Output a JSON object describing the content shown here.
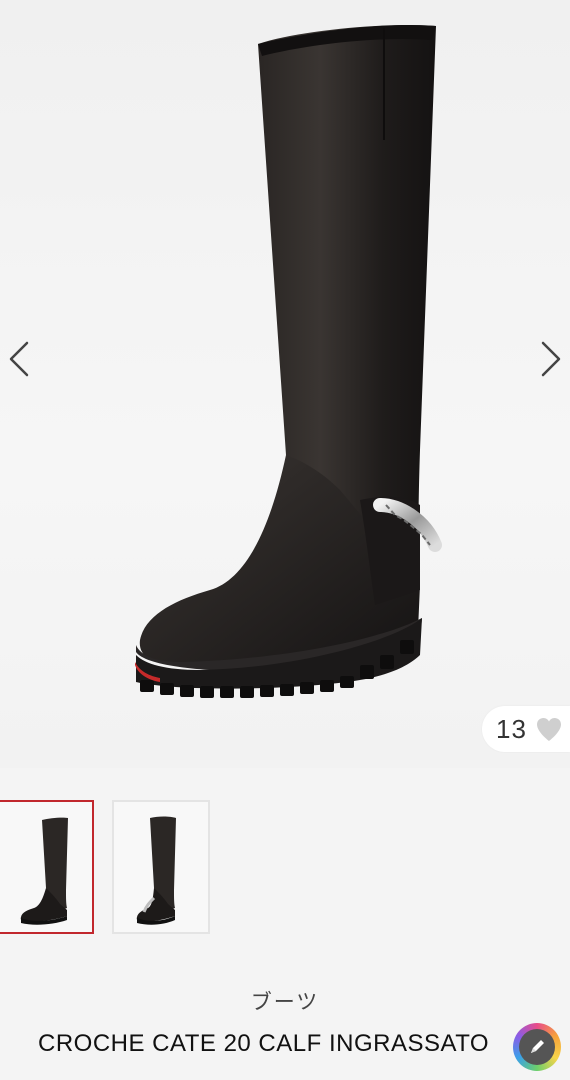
{
  "gallery": {
    "prev_icon": "chevron-left-icon",
    "next_icon": "chevron-right-icon",
    "like_count": "13",
    "like_icon": "heart-icon"
  },
  "thumbnails": [
    {
      "name": "thumbnail-side-view",
      "selected": true
    },
    {
      "name": "thumbnail-back-view",
      "selected": false
    }
  ],
  "product": {
    "category": "ブーツ",
    "name": "CROCHE CATE 20 CALF INGRASSATO"
  },
  "colors": {
    "selected_border": "#c1272d",
    "heart": "#cfcfcf",
    "background": "#f4f4f4"
  },
  "overlay": {
    "edit_icon": "pencil-icon"
  }
}
